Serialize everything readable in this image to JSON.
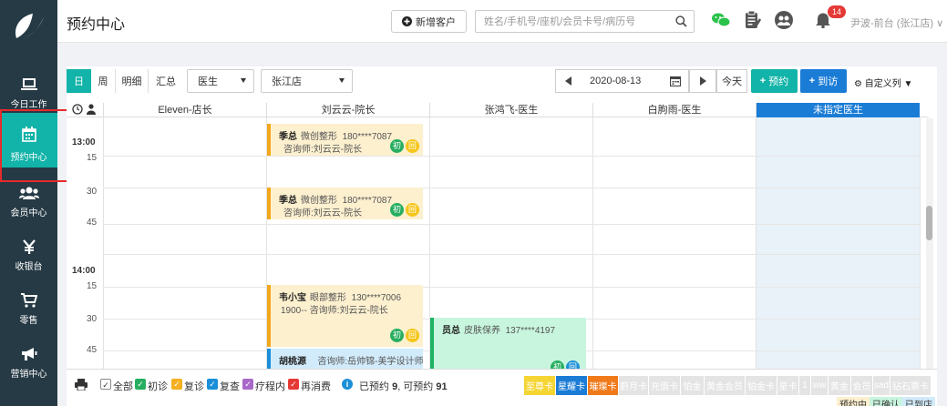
{
  "sidebar": {
    "items": [
      {
        "label": "今日工作",
        "icon": "laptop-icon"
      },
      {
        "label": "预约中心",
        "icon": "calendar-icon",
        "active": true
      },
      {
        "label": "会员中心",
        "icon": "members-icon"
      },
      {
        "label": "收银台",
        "icon": "yen-icon"
      },
      {
        "label": "零售",
        "icon": "cart-icon"
      },
      {
        "label": "营销中心",
        "icon": "megaphone-icon"
      }
    ]
  },
  "header": {
    "title": "预约中心",
    "new_customer_label": "新增客户",
    "search_placeholder": "姓名/手机号/座机/会员卡号/病历号",
    "notification_count": "14",
    "user": "尹波-前台 (张江店) ∨"
  },
  "toolbar": {
    "views": [
      "日",
      "周",
      "明细",
      "汇总"
    ],
    "role_select": "医生",
    "store_select": "张江店",
    "date": "2020-08-13",
    "today_label": "今天",
    "booking_label": "预约",
    "visit_label": "到访",
    "custom_col_label": "自定义列"
  },
  "grid": {
    "columns": [
      "Eleven-店长",
      "刘云云-院长",
      "张鸿飞-医生",
      "白朐雨-医生",
      "未指定医生"
    ],
    "times": [
      {
        "label": "13:00",
        "hour": true
      },
      {
        "label": "15",
        "hour": false
      },
      {
        "label": "30",
        "hour": false
      },
      {
        "label": "45",
        "hour": false
      },
      {
        "label": "14:00",
        "hour": true
      },
      {
        "label": "15",
        "hour": false
      },
      {
        "label": "30",
        "hour": false
      },
      {
        "label": "45",
        "hour": false
      }
    ]
  },
  "appointments": [
    {
      "name": "季总",
      "service": "微创整形",
      "phone": "180****7087",
      "line2": "咨询师:刘云云-院长",
      "tags": [
        "初",
        "回"
      ]
    },
    {
      "name": "季总",
      "service": "微创整形",
      "phone": "180****7087",
      "line2": "咨询师:刘云云-院长",
      "tags": [
        "初",
        "回"
      ]
    },
    {
      "name": "韦小宝",
      "service": "眼部整形",
      "phone": "130****7006",
      "line2": "1900--   咨询师:刘云云-院长",
      "tags": [
        "初",
        "回"
      ]
    },
    {
      "name": "胡桃源",
      "service": "咨询师:岳帅锦-美学设计师",
      "phone": "",
      "line2": "",
      "tags": []
    },
    {
      "name": "员总",
      "service": "皮肤保养",
      "phone": "137****4197",
      "line2": "",
      "tags": [
        "初",
        "回"
      ]
    }
  ],
  "legend": {
    "checks": [
      {
        "label": "全部",
        "color": "#ffffff"
      },
      {
        "label": "初诊",
        "color": "#27ae60"
      },
      {
        "label": "复诊",
        "color": "#f5b021"
      },
      {
        "label": "复查",
        "color": "#1a8fd8"
      },
      {
        "label": "疗程内",
        "color": "#a869c9"
      },
      {
        "label": "再消费",
        "color": "#e53935"
      }
    ],
    "booked_text": "已预约",
    "booked_count": "9",
    "available_text": "可预约",
    "available_count": "91",
    "cards": [
      "至尊卡",
      "星耀卡",
      "璀璨卡",
      "蔚月卡",
      "充值卡",
      "铂金",
      "黄金会员",
      "铂金卡",
      "星卡",
      "1",
      "ww",
      "黄金",
      "会员",
      "sad",
      "钻石票卡"
    ],
    "states": [
      "预约中",
      "已确认",
      "已到店"
    ]
  },
  "colors": {
    "sidebar": "#263a45",
    "accent": "#12b3a8",
    "primary": "#1b7cd6"
  }
}
